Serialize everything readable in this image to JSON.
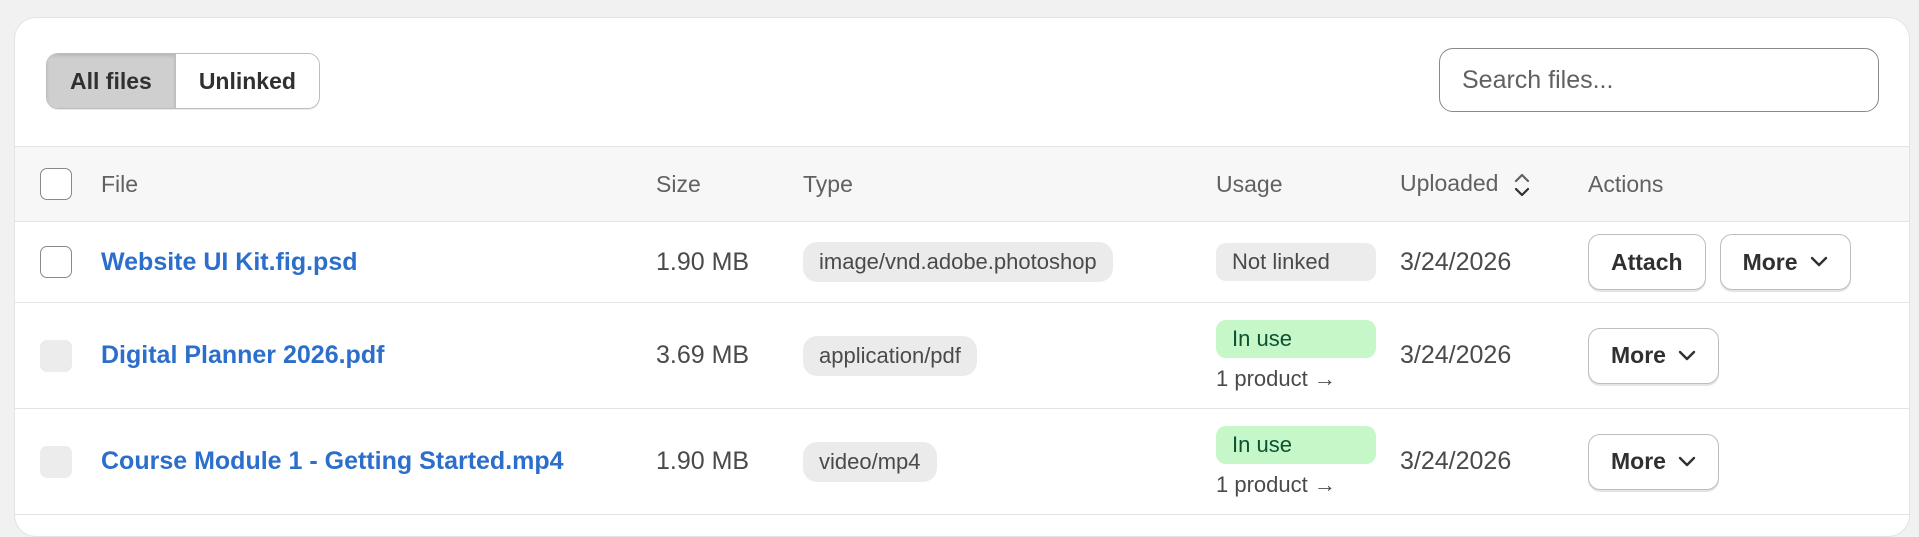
{
  "filter_tabs": [
    {
      "label": "All files",
      "active": true
    },
    {
      "label": "Unlinked",
      "active": false
    }
  ],
  "search": {
    "placeholder": "Search files...",
    "value": ""
  },
  "columns": {
    "file": "File",
    "size": "Size",
    "type": "Type",
    "usage": "Usage",
    "uploaded": "Uploaded",
    "actions": "Actions"
  },
  "rows": [
    {
      "name": "Website UI Kit.fig.psd",
      "size": "1.90 MB",
      "type": "image/vnd.adobe.photoshop",
      "usage_status": "Not linked",
      "usage_detail": "",
      "uploaded": "3/24/2026",
      "attach_label": "Attach",
      "more_label": "More"
    },
    {
      "name": "Digital Planner 2026.pdf",
      "size": "3.69 MB",
      "type": "application/pdf",
      "usage_status": "In use",
      "usage_detail": "1 product →",
      "uploaded": "3/24/2026",
      "more_label": "More"
    },
    {
      "name": "Course Module 1 - Getting Started.mp4",
      "size": "1.90 MB",
      "type": "video/mp4",
      "usage_status": "In use",
      "usage_detail": "1 product →",
      "uploaded": "3/24/2026",
      "more_label": "More"
    }
  ],
  "colors": {
    "link": "#2c6ecb",
    "in_use_bg": "#c5f7c9",
    "not_linked_bg": "#ececec",
    "active_tab_bg": "#cfcfcf"
  }
}
